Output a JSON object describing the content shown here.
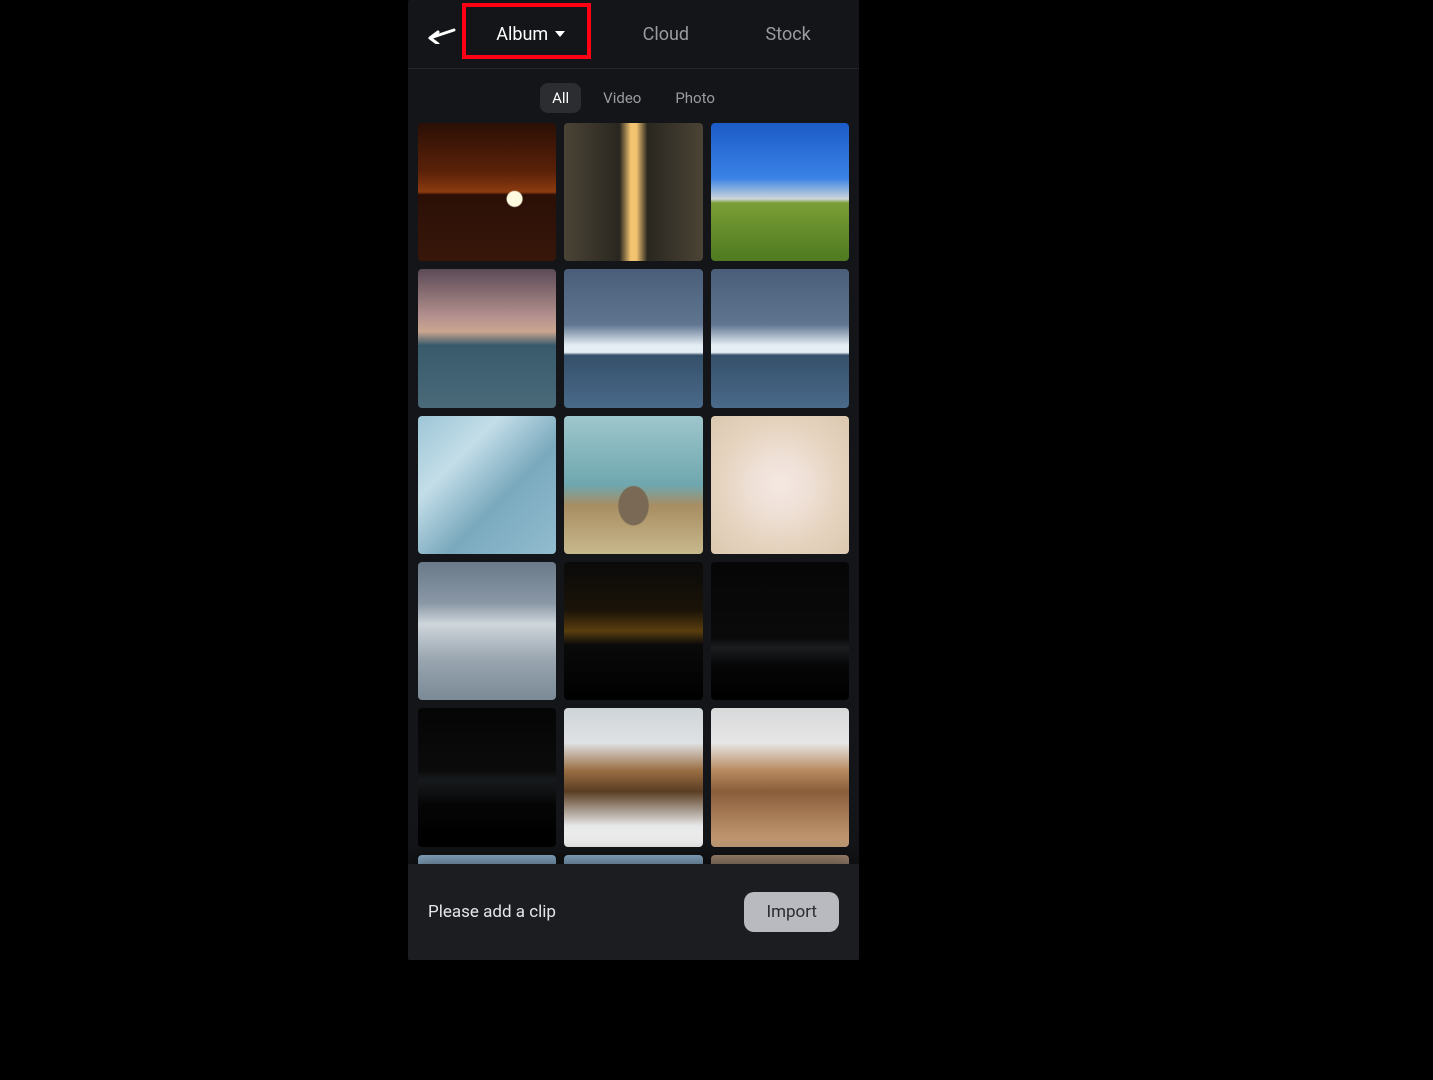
{
  "topnav": {
    "album_label": "Album",
    "album_active": true,
    "cloud_label": "Cloud",
    "stock_label": "Stock"
  },
  "filters": {
    "all": {
      "label": "All",
      "active": true
    },
    "video": {
      "label": "Video",
      "active": false
    },
    "photo": {
      "label": "Photo",
      "active": false
    }
  },
  "highlight": {
    "target": "album-tab"
  },
  "thumbs": [
    {
      "name": "sunset-over-water",
      "klass": "tp-sunset"
    },
    {
      "name": "slot-canyon",
      "klass": "tp-canyon"
    },
    {
      "name": "mountain-meadow",
      "klass": "tp-meadow"
    },
    {
      "name": "coastal-cliffs",
      "klass": "tp-coast"
    },
    {
      "name": "iceberg-sea-1",
      "klass": "tp-iceberg"
    },
    {
      "name": "iceberg-sea-2",
      "klass": "tp-iceberg"
    },
    {
      "name": "blue-glacier",
      "klass": "tp-glacier"
    },
    {
      "name": "seal-in-surf",
      "klass": "tp-seal"
    },
    {
      "name": "dandelion-macro",
      "klass": "tp-dandelion"
    },
    {
      "name": "ice-field",
      "klass": "tp-icefield"
    },
    {
      "name": "lightning-storm",
      "klass": "tp-storm"
    },
    {
      "name": "dark-mountain-1",
      "klass": "tp-nightmtn"
    },
    {
      "name": "dark-mountain-2",
      "klass": "tp-nightmtn2"
    },
    {
      "name": "rock-spires",
      "klass": "tp-spires"
    },
    {
      "name": "walrus-beach",
      "klass": "tp-walrus"
    },
    {
      "name": "sky-partial-1",
      "klass": "tp-blue",
      "short": true
    },
    {
      "name": "sky-partial-2",
      "klass": "tp-blue",
      "short": true
    },
    {
      "name": "sand-partial",
      "klass": "tp-tan",
      "short": true
    }
  ],
  "bottom": {
    "prompt": "Please add a clip",
    "import_label": "Import"
  }
}
